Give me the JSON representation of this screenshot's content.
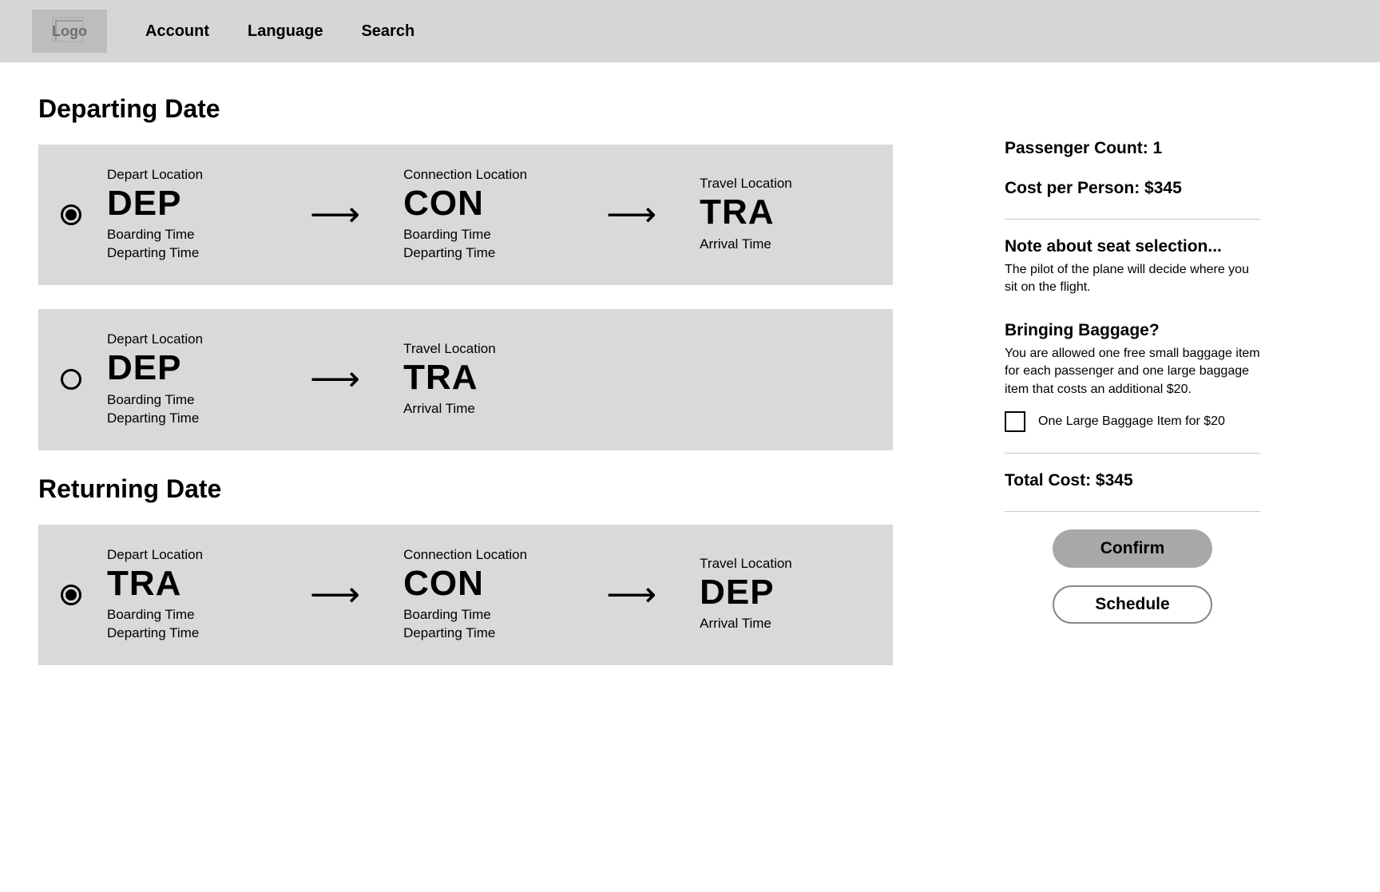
{
  "header": {
    "logo_text": "Logo",
    "nav": [
      "Account",
      "Language",
      "Search"
    ]
  },
  "departing_title": "Departing Date",
  "returning_title": "Returning Date",
  "flights": {
    "departing": [
      {
        "selected": true,
        "segments": [
          {
            "label": "Depart Location",
            "code": "DEP",
            "times": [
              "Boarding Time",
              "Departing Time"
            ]
          },
          {
            "label": "Connection Location",
            "code": "CON",
            "times": [
              "Boarding Time",
              "Departing Time"
            ]
          },
          {
            "label": "Travel Location",
            "code": "TRA",
            "times": [
              "Arrival Time"
            ]
          }
        ]
      },
      {
        "selected": false,
        "segments": [
          {
            "label": "Depart Location",
            "code": "DEP",
            "times": [
              "Boarding Time",
              "Departing Time"
            ]
          },
          {
            "label": "Travel Location",
            "code": "TRA",
            "times": [
              "Arrival Time"
            ]
          }
        ]
      }
    ],
    "returning": [
      {
        "selected": true,
        "segments": [
          {
            "label": "Depart Location",
            "code": "TRA",
            "times": [
              "Boarding Time",
              "Departing Time"
            ]
          },
          {
            "label": "Connection Location",
            "code": "CON",
            "times": [
              "Boarding Time",
              "Departing Time"
            ]
          },
          {
            "label": "Travel Location",
            "code": "DEP",
            "times": [
              "Arrival Time"
            ]
          }
        ]
      }
    ]
  },
  "sidebar": {
    "passenger_line": "Passenger Count: 1",
    "cost_line": "Cost per Person: $345",
    "note_title": "Note about seat selection...",
    "note_body": "The pilot of the plane will decide where you sit on the flight.",
    "baggage_title": "Bringing Baggage?",
    "baggage_body": "You are allowed one free small baggage item for each passenger and one large baggage item that costs an additional $20.",
    "baggage_checkbox_label": "One Large Baggage Item for $20",
    "total_line": "Total Cost: $345",
    "confirm_label": "Confirm",
    "schedule_label": "Schedule"
  }
}
